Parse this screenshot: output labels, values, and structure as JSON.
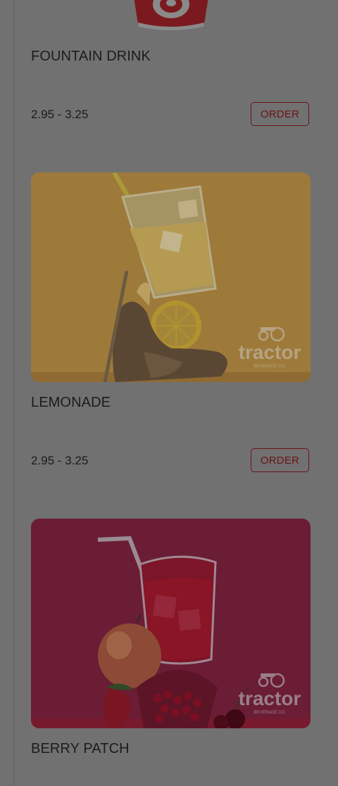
{
  "menu": {
    "items": [
      {
        "name": "FOUNTAIN DRINK",
        "price": "2.95 - 3.25",
        "order_label": "ORDER",
        "image_icon": "soda-cup-image"
      },
      {
        "name": "LEMONADE",
        "price": "2.95 - 3.25",
        "order_label": "ORDER",
        "image_icon": "lemonade-photo",
        "image_brand": "tractor",
        "image_brand_sub": "BEVERAGE CO.",
        "image_bg": "#9e7a3a"
      },
      {
        "name": "BERRY PATCH",
        "image_icon": "berry-drink-photo",
        "image_brand": "tractor",
        "image_brand_sub": "BEVERAGE CO.",
        "image_bg": "#6b1d35"
      }
    ]
  }
}
